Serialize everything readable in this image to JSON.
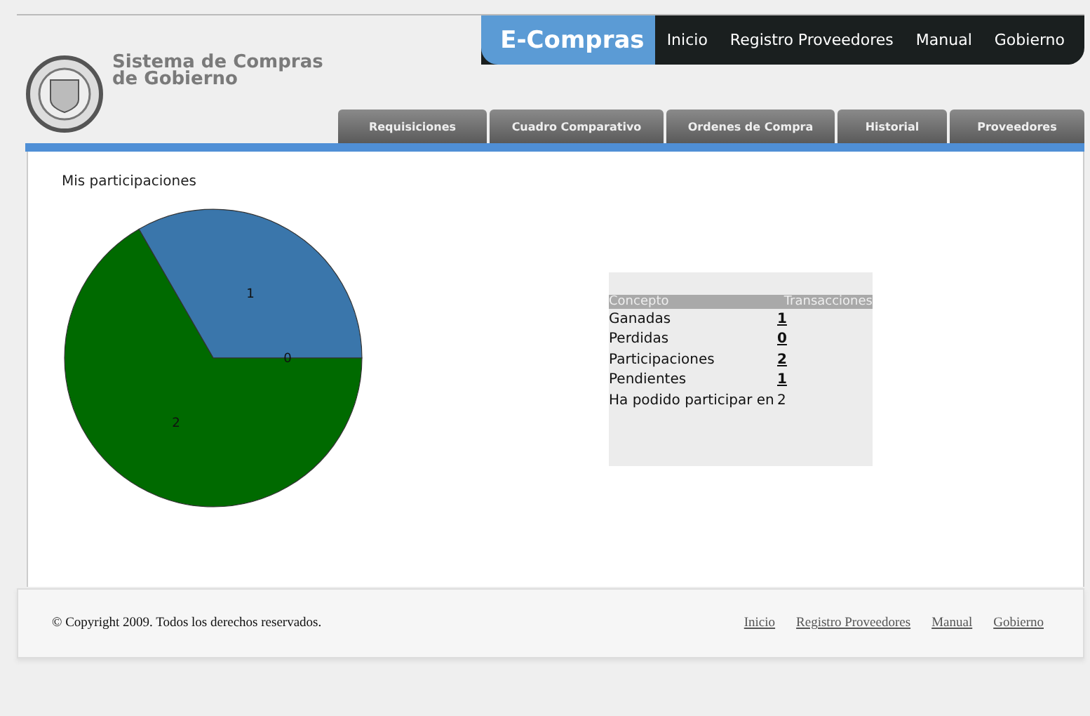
{
  "brand": {
    "title": "Sistema de Compras de Gobierno"
  },
  "top_nav": {
    "badge": "E-Compras",
    "links": [
      {
        "label": "Inicio"
      },
      {
        "label": "Registro Proveedores"
      },
      {
        "label": "Manual"
      },
      {
        "label": "Gobierno"
      }
    ]
  },
  "tabs": [
    {
      "label": "Requisiciones"
    },
    {
      "label": "Cuadro Comparativo"
    },
    {
      "label": "Ordenes de Compra"
    },
    {
      "label": "Historial"
    },
    {
      "label": "Proveedores"
    }
  ],
  "chart": {
    "heading": "Mis participaciones",
    "chart_data": {
      "type": "pie",
      "values": [
        1,
        0,
        2
      ],
      "value_labels": [
        "1",
        "0",
        "2"
      ]
    }
  },
  "summary": {
    "columns": [
      "Concepto",
      "Transacciones"
    ],
    "rows": [
      {
        "concept": "Ganadas",
        "value": "1",
        "link": true
      },
      {
        "concept": "Perdidas",
        "value": "0",
        "link": true
      },
      {
        "concept": "Participaciones",
        "value": "2",
        "link": true
      },
      {
        "concept": "Pendientes",
        "value": "1",
        "link": true
      },
      {
        "concept": "Ha podido participar en",
        "value": "2",
        "link": false
      }
    ]
  },
  "footer": {
    "copyright": "© Copyright 2009. Todos los derechos reservados.",
    "links": [
      {
        "label": "Inicio"
      },
      {
        "label": "Registro Proveedores"
      },
      {
        "label": "Manual"
      },
      {
        "label": "Gobierno"
      }
    ]
  }
}
